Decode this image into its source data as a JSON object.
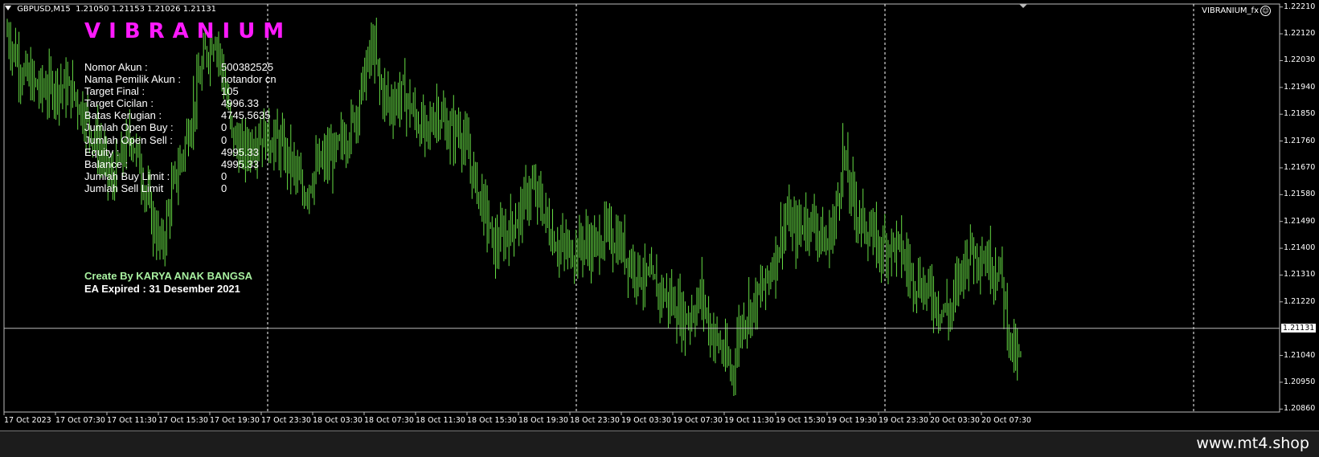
{
  "window": {
    "symbol": "GBPUSD,M15",
    "ohlc": "1.21050 1.21153 1.21026 1.21131",
    "ea_name": "VIBRANIUM_fx"
  },
  "panel": {
    "title": "VIBRANIUM",
    "rows": [
      {
        "label": "Nomor Akun :",
        "value": "500382525"
      },
      {
        "label": "Nama Pemilik Akun :",
        "value": "notandor cn"
      },
      {
        "label": "Target Final :",
        "value": "105"
      },
      {
        "label": "Target Cicilan :",
        "value": "4996.33"
      },
      {
        "label": "Batas Kerugian :",
        "value": "4745.5635"
      },
      {
        "label": "Jumlah Open Buy :",
        "value": "0"
      },
      {
        "label": "Jumlah Open Sell :",
        "value": "0"
      },
      {
        "label": "Equity :",
        "value": "4995.33"
      },
      {
        "label": "Balance :",
        "value": "4995.33"
      },
      {
        "label": "Jumlah Buy Limit :",
        "value": "0"
      },
      {
        "label": "Jumlah Sell Limit",
        "value": "0"
      }
    ],
    "credit": "Create By KARYA ANAK BANGSA",
    "expiry": "EA Expired : 31 Desember 2021"
  },
  "chart_data": {
    "type": "candlestick",
    "x_ticks": [
      "17 Oct 2023",
      "17 Oct 07:30",
      "17 Oct 11:30",
      "17 Oct 15:30",
      "17 Oct 19:30",
      "17 Oct 23:30",
      "18 Oct 03:30",
      "18 Oct 07:30",
      "18 Oct 11:30",
      "18 Oct 15:30",
      "18 Oct 19:30",
      "18 Oct 23:30",
      "19 Oct 03:30",
      "19 Oct 07:30",
      "19 Oct 11:30",
      "19 Oct 15:30",
      "19 Oct 19:30",
      "19 Oct 23:30",
      "20 Oct 03:30",
      "20 Oct 07:30"
    ],
    "y_ticks": [
      "1.22210",
      "1.22120",
      "1.22030",
      "1.21940",
      "1.21850",
      "1.21760",
      "1.21670",
      "1.21580",
      "1.21490",
      "1.21400",
      "1.21310",
      "1.21220",
      "1.21040",
      "1.20950",
      "1.20860"
    ],
    "ylim": [
      1.2085,
      1.2222
    ],
    "current_price": "1.21131",
    "close_path": [
      [
        0,
        1.2212
      ],
      [
        10,
        1.2198
      ],
      [
        20,
        1.2193
      ],
      [
        30,
        1.2195
      ],
      [
        40,
        1.2192
      ],
      [
        50,
        1.218
      ],
      [
        56,
        1.2172
      ],
      [
        62,
        1.2162
      ],
      [
        68,
        1.217
      ],
      [
        74,
        1.2178
      ],
      [
        80,
        1.2166
      ],
      [
        86,
        1.215
      ],
      [
        92,
        1.214
      ],
      [
        98,
        1.2158
      ],
      [
        106,
        1.2175
      ],
      [
        112,
        1.219
      ],
      [
        118,
        1.2205
      ],
      [
        124,
        1.2212
      ],
      [
        128,
        1.22
      ],
      [
        134,
        1.2178
      ],
      [
        140,
        1.2172
      ],
      [
        150,
        1.2178
      ],
      [
        160,
        1.2176
      ],
      [
        170,
        1.2168
      ],
      [
        176,
        1.2158
      ],
      [
        186,
        1.2168
      ],
      [
        196,
        1.2172
      ],
      [
        206,
        1.2182
      ],
      [
        214,
        1.22
      ],
      [
        218,
        1.2208
      ],
      [
        222,
        1.2195
      ],
      [
        228,
        1.2188
      ],
      [
        236,
        1.2192
      ],
      [
        244,
        1.2183
      ],
      [
        250,
        1.2178
      ],
      [
        256,
        1.2187
      ],
      [
        262,
        1.2179
      ],
      [
        270,
        1.218
      ],
      [
        278,
        1.2164
      ],
      [
        286,
        1.215
      ],
      [
        290,
        1.214
      ],
      [
        296,
        1.2144
      ],
      [
        304,
        1.215
      ],
      [
        312,
        1.216
      ],
      [
        318,
        1.2155
      ],
      [
        324,
        1.2145
      ],
      [
        330,
        1.214
      ],
      [
        336,
        1.2139
      ],
      [
        344,
        1.2142
      ],
      [
        350,
        1.214
      ],
      [
        356,
        1.2145
      ],
      [
        364,
        1.2142
      ],
      [
        372,
        1.2135
      ],
      [
        380,
        1.213
      ],
      [
        388,
        1.2126
      ],
      [
        396,
        1.2122
      ],
      [
        404,
        1.2116
      ],
      [
        410,
        1.212
      ],
      [
        414,
        1.2125
      ],
      [
        418,
        1.2114
      ],
      [
        424,
        1.2108
      ],
      [
        428,
        1.2103
      ],
      [
        432,
        1.2098
      ],
      [
        436,
        1.2112
      ],
      [
        440,
        1.2118
      ],
      [
        446,
        1.2122
      ],
      [
        452,
        1.2128
      ],
      [
        458,
        1.2138
      ],
      [
        464,
        1.215
      ],
      [
        470,
        1.2145
      ],
      [
        476,
        1.215
      ],
      [
        482,
        1.2148
      ],
      [
        488,
        1.214
      ],
      [
        494,
        1.2152
      ],
      [
        498,
        1.2172
      ],
      [
        502,
        1.216
      ],
      [
        508,
        1.215
      ],
      [
        514,
        1.2145
      ],
      [
        520,
        1.214
      ],
      [
        526,
        1.2142
      ],
      [
        532,
        1.214
      ],
      [
        538,
        1.2132
      ],
      [
        544,
        1.2128
      ],
      [
        550,
        1.2125
      ],
      [
        556,
        1.212
      ],
      [
        562,
        1.2118
      ],
      [
        568,
        1.2132
      ],
      [
        574,
        1.214
      ],
      [
        580,
        1.2138
      ],
      [
        586,
        1.2135
      ],
      [
        592,
        1.2132
      ],
      [
        598,
        1.2108
      ],
      [
        602,
        1.2102
      ],
      [
        606,
        1.2106
      ],
      [
        610,
        1.2112
      ]
    ]
  },
  "footer": {
    "watermark": "www.mt4.shop"
  }
}
